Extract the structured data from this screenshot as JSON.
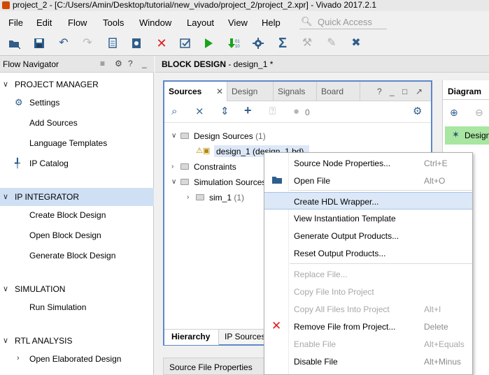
{
  "window": {
    "title": "project_2 - [C:/Users/Amin/Desktop/tutorial/new_vivado/project_2/project_2.xpr] - Vivado 2017.2.1"
  },
  "menubar": {
    "items": [
      "File",
      "Edit",
      "Flow",
      "Tools",
      "Window",
      "Layout",
      "View",
      "Help"
    ],
    "quick_access_placeholder": "Quick Access"
  },
  "toolbar": {
    "icons": [
      "open-project-icon",
      "save-icon",
      "undo-icon",
      "redo-icon",
      "copy-icon",
      "delete-icon",
      "close-icon",
      "check-icon",
      "run-icon",
      "program-icon",
      "settings-icon",
      "sum-icon",
      "tool-icon",
      "edit-icon",
      "debug-icon"
    ]
  },
  "flow_navigator": {
    "header": "Flow Navigator",
    "sections": [
      {
        "label": "PROJECT MANAGER",
        "items": [
          "Settings",
          "Add Sources",
          "Language Templates",
          "IP Catalog"
        ]
      },
      {
        "label": "IP INTEGRATOR",
        "items": [
          "Create Block Design",
          "Open Block Design",
          "Generate Block Design"
        ]
      },
      {
        "label": "SIMULATION",
        "items": [
          "Run Simulation"
        ]
      },
      {
        "label": "RTL ANALYSIS",
        "items": [
          "Open Elaborated Design"
        ]
      }
    ]
  },
  "block_design": {
    "header_bold": "BLOCK DESIGN",
    "header_rest": " - design_1 *"
  },
  "sources_panel": {
    "tabs": [
      "Sources",
      "Design",
      "Signals",
      "Board"
    ],
    "badge_count": "0",
    "tree": {
      "design_sources": "Design Sources",
      "design_sources_count": "(1)",
      "design_1": "design_1 (design_1.bd)",
      "constraints": "Constraints",
      "simulation_sources": "Simulation Sources",
      "sim_1": "sim_1",
      "sim_1_count": "(1)"
    },
    "bottom_tabs": [
      "Hierarchy",
      "IP Sources"
    ]
  },
  "source_file_properties": {
    "title": "Source File Properties"
  },
  "diagram_panel": {
    "tab": "Diagram",
    "item": "Design"
  },
  "context_menu": {
    "items": [
      {
        "label": "Source Node Properties...",
        "shortcut": "Ctrl+E",
        "enabled": true
      },
      {
        "label": "Open File",
        "shortcut": "Alt+O",
        "enabled": true
      },
      {
        "label": "Create HDL Wrapper...",
        "shortcut": "",
        "enabled": true,
        "highlighted": true
      },
      {
        "label": "View Instantiation Template",
        "shortcut": "",
        "enabled": true
      },
      {
        "label": "Generate Output Products...",
        "shortcut": "",
        "enabled": true
      },
      {
        "label": "Reset Output Products...",
        "shortcut": "",
        "enabled": true
      },
      {
        "label": "Replace File...",
        "shortcut": "",
        "enabled": false
      },
      {
        "label": "Copy File Into Project",
        "shortcut": "",
        "enabled": false
      },
      {
        "label": "Copy All Files Into Project",
        "shortcut": "Alt+I",
        "enabled": false
      },
      {
        "label": "Remove File from Project...",
        "shortcut": "Delete",
        "enabled": true
      },
      {
        "label": "Enable File",
        "shortcut": "Alt+Equals",
        "enabled": false
      },
      {
        "label": "Disable File",
        "shortcut": "Alt+Minus",
        "enabled": true
      }
    ]
  }
}
